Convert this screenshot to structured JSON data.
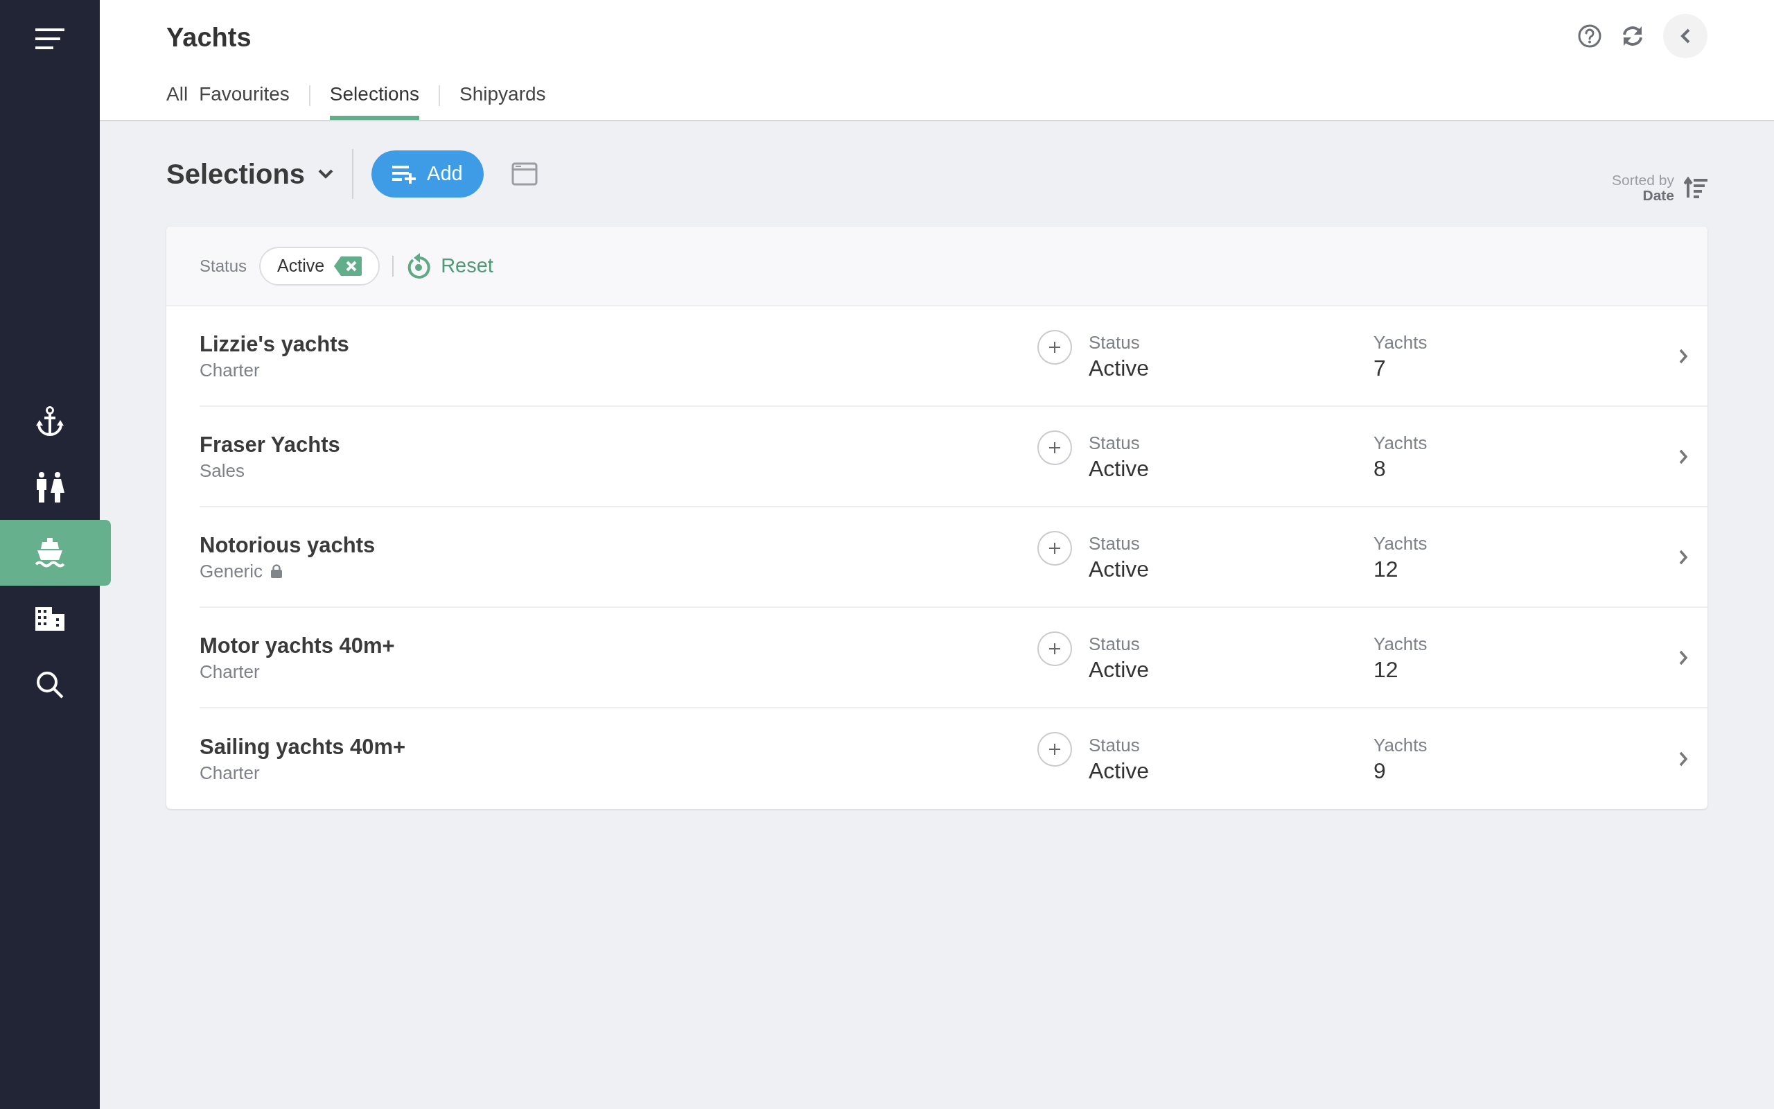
{
  "sidebar": {
    "items": [
      {
        "kind": "anchor",
        "selected": false
      },
      {
        "kind": "people",
        "selected": false
      },
      {
        "kind": "boat",
        "selected": true
      },
      {
        "kind": "building",
        "selected": false
      },
      {
        "kind": "search",
        "selected": false
      }
    ]
  },
  "header": {
    "title": "Yachts"
  },
  "tabs": [
    {
      "label": "All",
      "selected": false
    },
    {
      "label": "Favourites",
      "selected": false
    },
    {
      "label": "Selections",
      "selected": true
    },
    {
      "label": "Shipyards",
      "selected": false
    }
  ],
  "toolbar": {
    "heading": "Selections",
    "add_button": "Add",
    "sort_label": "Sorted by",
    "sort_value": "Date"
  },
  "filters": {
    "label": "Status",
    "chip": "Active",
    "reset": "Reset"
  },
  "rows": [
    {
      "name": "Lizzie's yachts",
      "type": "Charter",
      "locked": false,
      "status_label": "Status",
      "status": "Active",
      "yachts_label": "Yachts",
      "yachts": "7"
    },
    {
      "name": "Fraser Yachts",
      "type": "Sales",
      "locked": false,
      "status_label": "Status",
      "status": "Active",
      "yachts_label": "Yachts",
      "yachts": "8"
    },
    {
      "name": "Notorious yachts",
      "type": "Generic",
      "locked": true,
      "status_label": "Status",
      "status": "Active",
      "yachts_label": "Yachts",
      "yachts": "12"
    },
    {
      "name": "Motor yachts 40m+",
      "type": "Charter",
      "locked": false,
      "status_label": "Status",
      "status": "Active",
      "yachts_label": "Yachts",
      "yachts": "12"
    },
    {
      "name": "Sailing yachts 40m+",
      "type": "Charter",
      "locked": false,
      "status_label": "Status",
      "status": "Active",
      "yachts_label": "Yachts",
      "yachts": "9"
    }
  ]
}
